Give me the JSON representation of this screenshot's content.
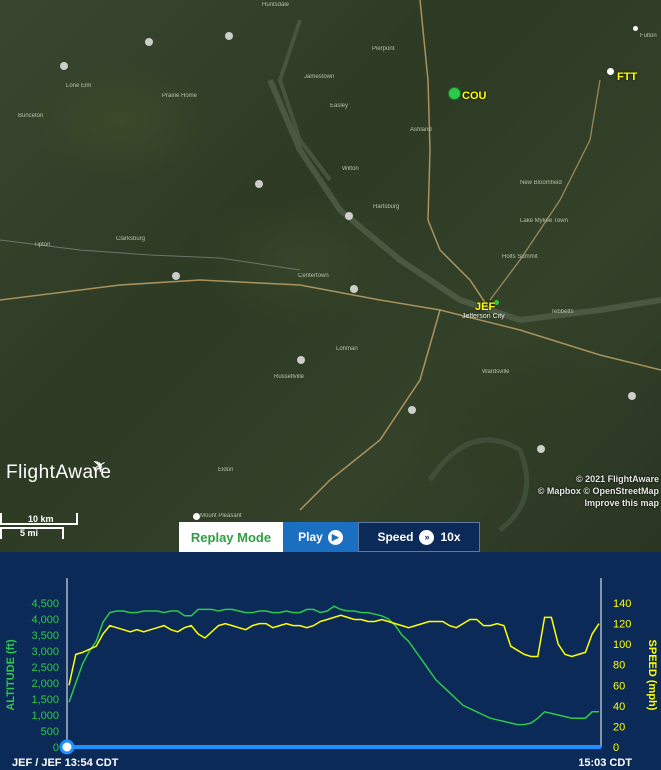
{
  "map": {
    "airports": [
      {
        "code": "COU",
        "color": "#2ec84a"
      },
      {
        "code": "FTT",
        "color": "#ffffff"
      },
      {
        "code": "JEF",
        "color": "#2ec84a"
      }
    ],
    "towns": [
      "Huntsdale",
      "Jamestown",
      "Prairie Home",
      "Pierpont",
      "Ashland",
      "Lone Elm",
      "Bunceton",
      "Clarksburg",
      "Easley",
      "Wilton",
      "Hartsburg",
      "Tipton",
      "Clarksburg",
      "Centertown",
      "Lohman",
      "Russellville",
      "Wardsville",
      "Eldon",
      "Jefferson City",
      "Holts Summit",
      "New Bloomfield",
      "Lake Mykee Town",
      "Fulton",
      "Tebbetts",
      "Olean",
      "Henley",
      "Mount Pleasant"
    ],
    "credits": [
      "© 2021 FlightAware",
      "© Mapbox © OpenStreetMap",
      "Improve this map"
    ],
    "logo": "FlightAware",
    "scale": {
      "km": "10 km",
      "mi": "5 mi"
    }
  },
  "replay": {
    "mode_label": "Replay Mode",
    "play_label": "Play",
    "speed_label": "Speed",
    "speed_value": "10x"
  },
  "chart_data": {
    "type": "line",
    "ylabel_left": "ALTITUDE (ft)",
    "ylabel_right": "SPEED (mph)",
    "left_ticks": [
      "4,500",
      "4,000",
      "3,500",
      "3,000",
      "2,500",
      "2,000",
      "1,500",
      "1,000",
      "500",
      "0"
    ],
    "right_ticks": [
      "140",
      "120",
      "100",
      "80",
      "60",
      "40",
      "20",
      "0"
    ],
    "ylim_left": [
      0,
      4500
    ],
    "ylim_right": [
      0,
      140
    ],
    "x_start_label": "JEF / JEF 13:54 CDT",
    "x_end_label": "15:03 CDT",
    "series": [
      {
        "name": "Altitude",
        "axis": "left",
        "color": "#2ec84a",
        "values": [
          1400,
          2000,
          2600,
          3000,
          3300,
          3900,
          4200,
          4250,
          4250,
          4200,
          4200,
          4250,
          4250,
          4250,
          4200,
          4250,
          4250,
          4100,
          4100,
          4300,
          4300,
          4300,
          4250,
          4300,
          4300,
          4250,
          4200,
          4200,
          4250,
          4250,
          4200,
          4200,
          4250,
          4200,
          4200,
          4300,
          4300,
          4200,
          4250,
          4400,
          4300,
          4250,
          4250,
          4200,
          4200,
          4150,
          4100,
          4000,
          3800,
          3500,
          3300,
          3000,
          2700,
          2400,
          2100,
          1900,
          1700,
          1500,
          1300,
          1200,
          1100,
          1000,
          900,
          850,
          800,
          750,
          700,
          700,
          750,
          900,
          1100,
          1050,
          1000,
          950,
          900,
          900,
          900,
          1100,
          1100
        ]
      },
      {
        "name": "Speed",
        "axis": "right",
        "color": "#ffff00",
        "values": [
          60,
          90,
          92,
          95,
          98,
          110,
          118,
          116,
          114,
          112,
          114,
          112,
          114,
          116,
          118,
          114,
          112,
          116,
          118,
          110,
          106,
          112,
          118,
          120,
          118,
          116,
          114,
          118,
          120,
          120,
          116,
          118,
          120,
          118,
          118,
          116,
          118,
          122,
          124,
          126,
          128,
          126,
          124,
          124,
          122,
          122,
          124,
          122,
          120,
          118,
          116,
          118,
          120,
          122,
          122,
          122,
          118,
          116,
          120,
          124,
          124,
          118,
          118,
          120,
          118,
          98,
          94,
          90,
          88,
          88,
          126,
          126,
          100,
          90,
          88,
          90,
          92,
          110,
          120
        ]
      }
    ]
  }
}
